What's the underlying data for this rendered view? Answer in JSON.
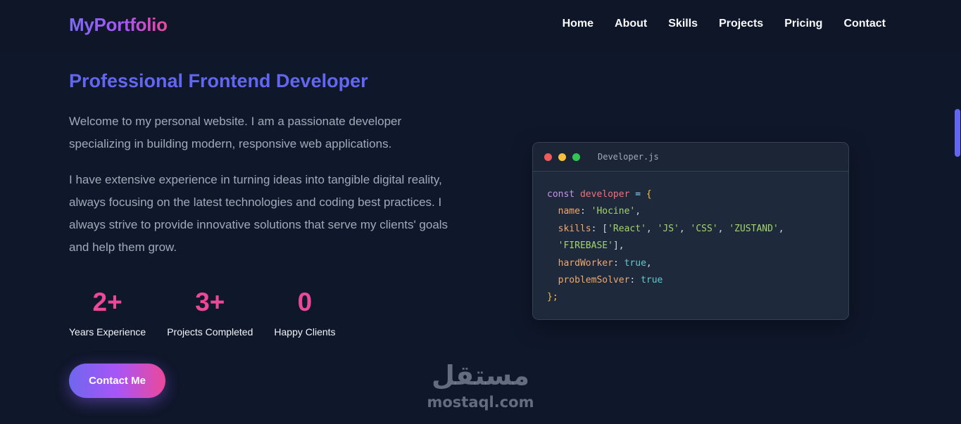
{
  "header": {
    "logo": "MyPortfolio",
    "nav": [
      {
        "label": "Home"
      },
      {
        "label": "About"
      },
      {
        "label": "Skills"
      },
      {
        "label": "Projects"
      },
      {
        "label": "Pricing"
      },
      {
        "label": "Contact"
      }
    ]
  },
  "hero": {
    "title": "Professional Frontend Developer",
    "paragraph1": "Welcome to my personal website. I am a passionate developer specializing in building modern, responsive web applications.",
    "paragraph2": "I have extensive experience in turning ideas into tangible digital reality, always focusing on the latest technologies and coding best practices. I always strive to provide innovative solutions that serve my clients' goals and help them grow.",
    "stats": [
      {
        "value": "2+",
        "label": "Years Experience"
      },
      {
        "value": "3+",
        "label": "Projects Completed"
      },
      {
        "value": "0",
        "label": "Happy Clients"
      }
    ],
    "contact_button": "Contact Me"
  },
  "code_window": {
    "filename": "Developer.js",
    "keyword": "const",
    "variable": "developer",
    "operator": "=",
    "open_brace": "{",
    "close_brace": "};",
    "name_key": "name",
    "name_value": "'Hocine'",
    "skills_key": "skills",
    "skills": [
      "'React'",
      "'JS'",
      "'CSS'",
      "'ZUSTAND'",
      "'FIREBASE'"
    ],
    "hardworker_key": "hardWorker",
    "hardworker_value": "true",
    "problemsolver_key": "problemSolver",
    "problemsolver_value": "true"
  },
  "watermark": {
    "arabic": "مستقل",
    "latin": "mostaql.com"
  },
  "colors": {
    "background": "#0f172a",
    "accent_indigo": "#6366f1",
    "accent_pink": "#ec4899",
    "accent_purple": "#a855f7"
  }
}
